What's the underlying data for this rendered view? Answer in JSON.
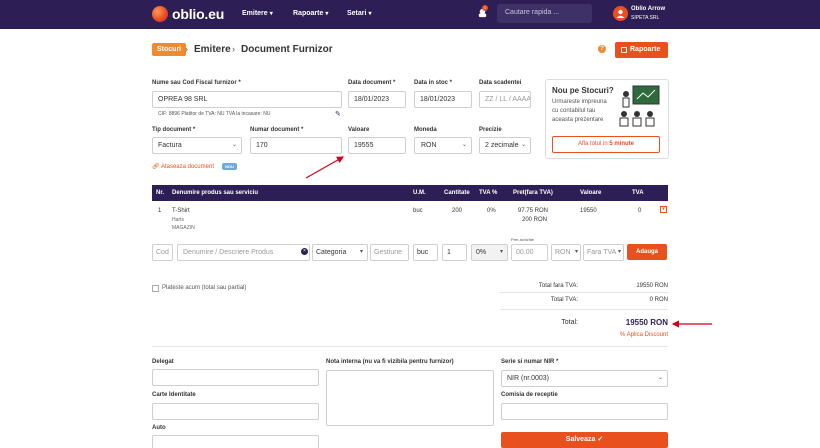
{
  "navbar": {
    "brand": "oblio.eu",
    "menu": [
      {
        "label": "Emitere"
      },
      {
        "label": "Rapoarte"
      },
      {
        "label": "Setari"
      }
    ],
    "notifications_count": "1",
    "search_placeholder": "Cautare rapida ...",
    "user_name": "Oblio Arrow",
    "company": "SIPETA SRL"
  },
  "breadcrumb": {
    "root": "Stocuri",
    "level1": "Emitere",
    "level2": "Document Furnizor"
  },
  "header_actions": {
    "help": "?",
    "reports_button": "Rapoarte"
  },
  "form": {
    "supplier_label": "Nume sau Cod Fiscal furnizor *",
    "supplier_value": "OPREA 98 SRL",
    "supplier_note": "CIF: 8896   Platitor de TVA: NU   TVA la incasare: NU",
    "doc_date_label": "Data document *",
    "doc_date_value": "18/01/2023",
    "stock_date_label": "Data in stoc *",
    "stock_date_value": "18/01/2023",
    "due_date_label": "Data scadentei",
    "due_date_placeholder": "ZZ / LL / AAAA",
    "doc_type_label": "Tip document *",
    "doc_type_value": "Factura",
    "doc_number_label": "Numar document *",
    "doc_number_value": "170",
    "value_label": "Valoare",
    "value_value": "19555",
    "currency_label": "Moneda",
    "currency_value": "RON",
    "precision_label": "Precizie",
    "precision_value": "2 zecimale",
    "attach_link": "Ataseaza document",
    "attach_badge": "NOU"
  },
  "promo": {
    "title": "Nou pe Stocuri?",
    "lines": [
      "Urmareste impreuna",
      "cu contabilul tau",
      "aceasta prezentare"
    ],
    "button_prefix": "Afla totul in",
    "button_bold": "5 minute"
  },
  "table": {
    "headers": [
      "Nr.",
      "Denumire produs sau serviciu",
      "U.M.",
      "Cantitate",
      "TVA %",
      "Pret(fara TVA)",
      "Valoare",
      "TVA"
    ],
    "rows": [
      {
        "nr": "1",
        "name": "T-Shirt",
        "brand": "Harts",
        "location": "MAGAZIN",
        "um": "buc",
        "qty": "200",
        "vat": "0%",
        "price": "97.75 RON",
        "price2": "200 RON",
        "value": "19550",
        "vat_value": "0"
      }
    ]
  },
  "add_row": {
    "code_placeholder": "Cod",
    "name_placeholder": "Denumire / Descriere Produs",
    "category": "Categoria",
    "management_placeholder": "Gestiune",
    "um": "buc",
    "qty": "1",
    "vat": "0%",
    "price_label": "Pret achizitie",
    "price_placeholder": "00.00",
    "currency": "RON",
    "vat_mode": "Fara TVA",
    "add_button": "Adauga"
  },
  "payment": {
    "pay_now_label": "Plateste acum (total sau partial)"
  },
  "totals": {
    "net_label": "Total fara TVA:",
    "net_value": "19550 RON",
    "vat_label": "Total TVA:",
    "vat_value": "0 RON",
    "grand_label": "Total:",
    "grand_value": "19550 RON",
    "discount_link": "% Aplica Discount"
  },
  "footer_form": {
    "delegate_label": "Delegat",
    "id_card_label": "Carte Identitate",
    "auto_label": "Auto",
    "note_label": "Nota interna (nu va fi vizibila pentru furnizor)",
    "nir_label": "Serie si numar NIR *",
    "nir_value": "NIR (nr.0003)",
    "commission_label": "Comisia de receptie",
    "save_button": "Salveaza"
  },
  "colors": {
    "navbar": "#2d1f55",
    "accent": "#e8501d",
    "annotation_arrow": "#d0021b"
  }
}
